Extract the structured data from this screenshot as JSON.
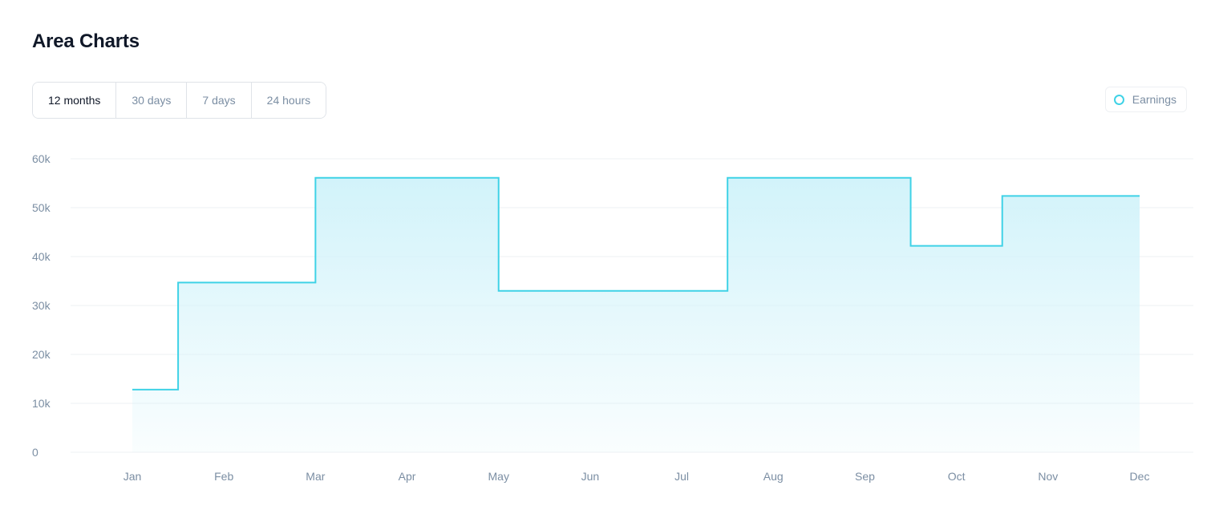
{
  "page": {
    "title": "Area Charts"
  },
  "range_tabs": [
    {
      "label": "12 months",
      "active": true
    },
    {
      "label": "30 days",
      "active": false
    },
    {
      "label": "7 days",
      "active": false
    },
    {
      "label": "24 hours",
      "active": false
    }
  ],
  "colors": {
    "series_line": "#3fd2e6",
    "area_fill_top": "#d2f3fa",
    "gridline": "#eef0f3",
    "tick_label": "#7b8ea3"
  },
  "chart_data": {
    "type": "area",
    "step": true,
    "title": "",
    "xlabel": "",
    "ylabel": "",
    "categories": [
      "Jan",
      "Feb",
      "Mar",
      "Apr",
      "May",
      "Jun",
      "Jul",
      "Aug",
      "Sep",
      "Oct",
      "Nov",
      "Dec"
    ],
    "series": [
      {
        "name": "Earnings",
        "points": [
          {
            "x": "Jan",
            "y": 12800
          },
          {
            "x": "Feb",
            "y": 34700
          },
          {
            "x": "Apr",
            "y": 56100
          },
          {
            "x": "Jun",
            "y": 33000
          },
          {
            "x": "Sep",
            "y": 56100
          },
          {
            "x": "Oct",
            "y": 42200
          },
          {
            "x": "Nov",
            "y": 52400
          },
          {
            "x": "Dec",
            "y": 52400
          }
        ]
      }
    ],
    "ylim": [
      0,
      60000
    ],
    "y_ticks": [
      0,
      10000,
      20000,
      30000,
      40000,
      50000,
      60000
    ],
    "y_tick_labels": [
      "0",
      "10k",
      "20k",
      "30k",
      "40k",
      "50k",
      "60k"
    ],
    "grid": true,
    "legend_position": "top-right"
  }
}
